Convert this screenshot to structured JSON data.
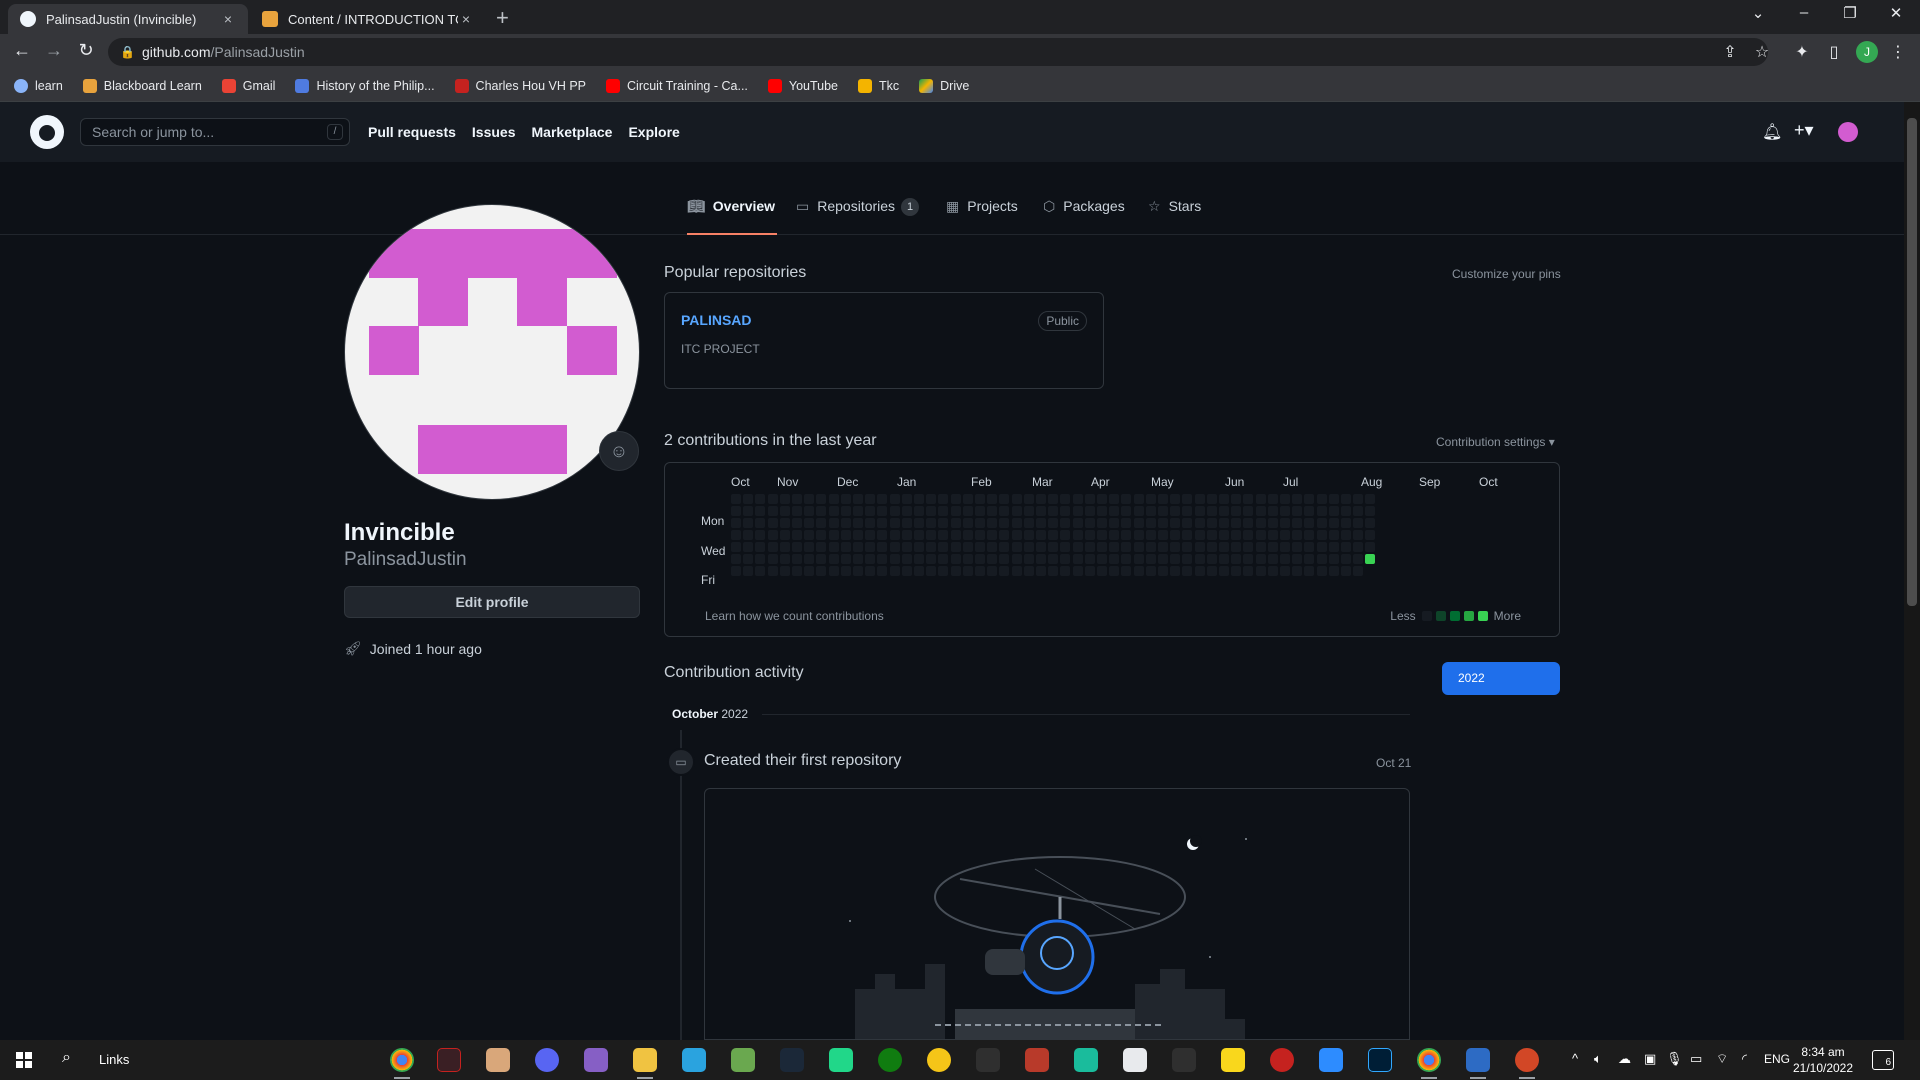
{
  "browser": {
    "tabs": [
      {
        "title": "PalinsadJustin (Invincible)",
        "close": "×"
      },
      {
        "title": "Content / INTRODUCTION TO CC",
        "close": "×"
      }
    ],
    "new_tab": "+",
    "url_domain": "github.com",
    "url_path": "/PalinsadJustin",
    "profile_initial": "J",
    "bookmarks": [
      "learn",
      "Blackboard Learn",
      "Gmail",
      "History of the Philip...",
      "Charles Hou VH PP",
      "Circuit Training - Ca...",
      "YouTube",
      "Tkc",
      "Drive"
    ]
  },
  "github": {
    "search_placeholder": "Search or jump to...",
    "search_key": "/",
    "nav": [
      "Pull requests",
      "Issues",
      "Marketplace",
      "Explore"
    ],
    "tabs": {
      "overview": "Overview",
      "repositories": "Repositories",
      "repositories_count": "1",
      "projects": "Projects",
      "packages": "Packages",
      "stars": "Stars"
    }
  },
  "profile": {
    "name": "Invincible",
    "login": "PalinsadJustin",
    "edit_label": "Edit profile",
    "joined": "Joined 1 hour ago",
    "avatar_color": "#d25cd0"
  },
  "popular": {
    "title": "Popular repositories",
    "customize": "Customize your pins",
    "repo_name": "PALINSAD",
    "repo_visibility": "Public",
    "repo_desc": "ITC PROJECT"
  },
  "contributions": {
    "title": "2 contributions in the last year",
    "settings": "Contribution settings ▾",
    "months": [
      "Oct",
      "Nov",
      "Dec",
      "Jan",
      "Feb",
      "Mar",
      "Apr",
      "May",
      "Jun",
      "Jul",
      "Aug",
      "Sep",
      "Oct"
    ],
    "days": [
      "Mon",
      "Wed",
      "Fri"
    ],
    "learn": "Learn how we count contributions",
    "legend_less": "Less",
    "legend_more": "More",
    "level_colors": [
      "#161b22",
      "#0e4429",
      "#006d32",
      "#26a641",
      "#39d353"
    ]
  },
  "activity": {
    "title": "Contribution activity",
    "year": "2022",
    "month": "October",
    "month_year": "2022",
    "event": "Created their first repository",
    "event_date": "Oct 21"
  },
  "taskbar": {
    "links_label": "Links",
    "lang": "ENG",
    "time": "8:34 am",
    "date": "21/10/2022",
    "notifications": "6"
  }
}
